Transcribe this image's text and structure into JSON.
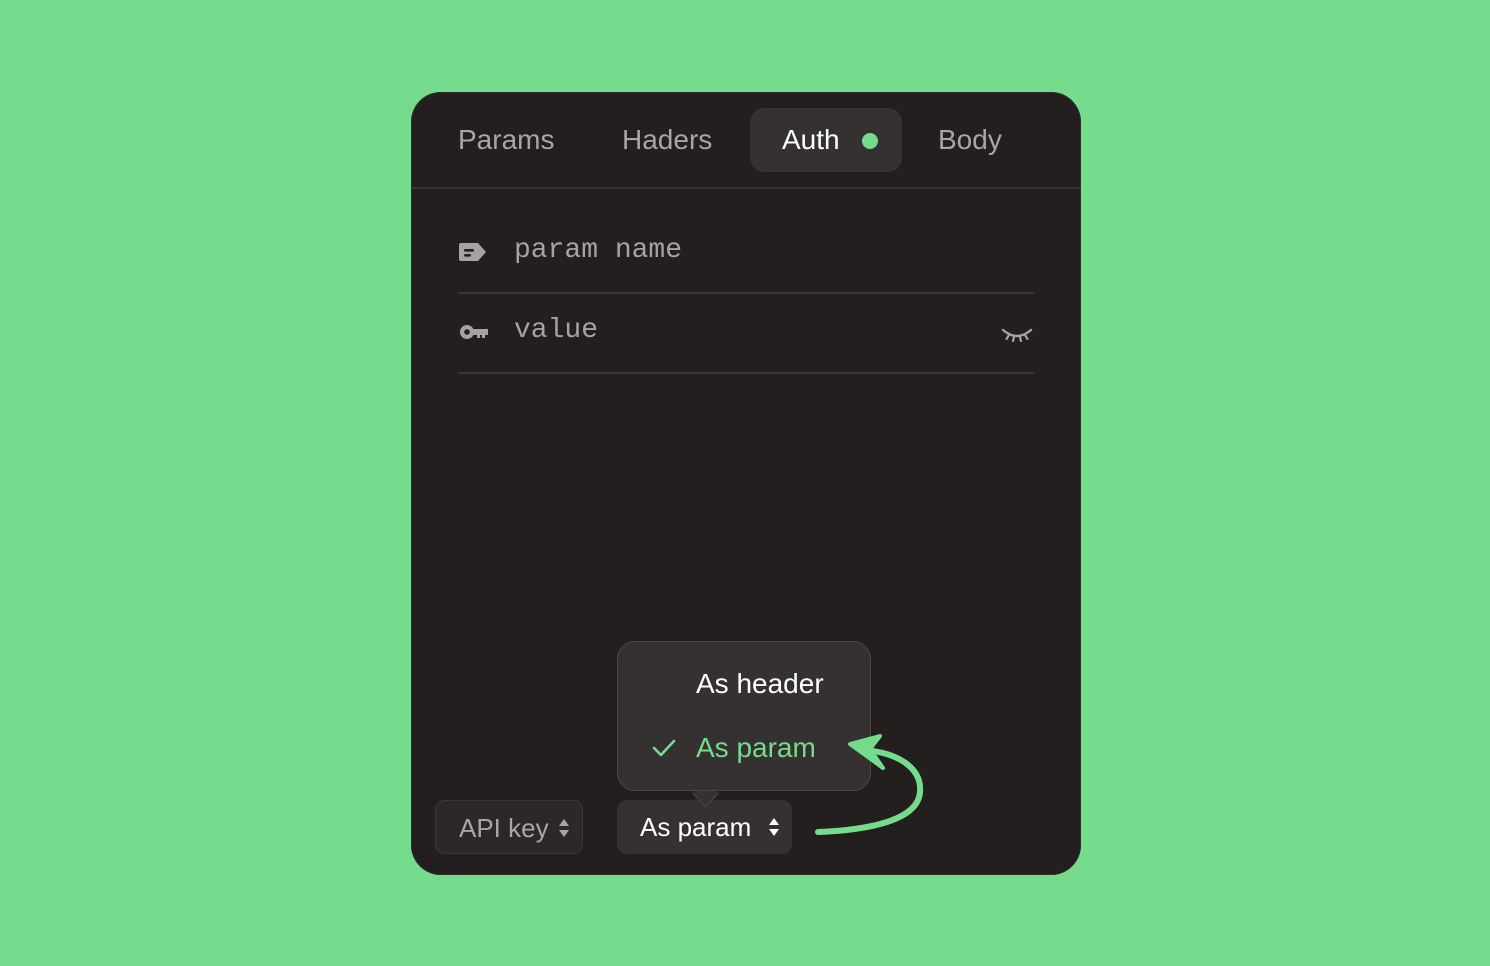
{
  "colors": {
    "accent": "#74dc8c",
    "panel_bg": "#231f1f",
    "control_bg": "#353131"
  },
  "tabs": [
    {
      "label": "Params",
      "active": false
    },
    {
      "label": "Haders",
      "active": false
    },
    {
      "label": "Auth",
      "active": true,
      "indicator": "status-dot"
    },
    {
      "label": "Body",
      "active": false
    }
  ],
  "fields": {
    "param_name": {
      "placeholder": "param name",
      "icon": "tag-icon"
    },
    "value": {
      "placeholder": "value",
      "icon": "key-icon",
      "toggle_icon": "eye-closed-icon"
    }
  },
  "footer": {
    "auth_type": {
      "value": "API key",
      "icon": "chevron-updown-icon"
    },
    "placement": {
      "value": "As param",
      "icon": "chevron-updown-icon"
    }
  },
  "dropdown": {
    "options": [
      {
        "label": "As header",
        "selected": false
      },
      {
        "label": "As param",
        "selected": true,
        "icon": "check-icon"
      }
    ]
  }
}
